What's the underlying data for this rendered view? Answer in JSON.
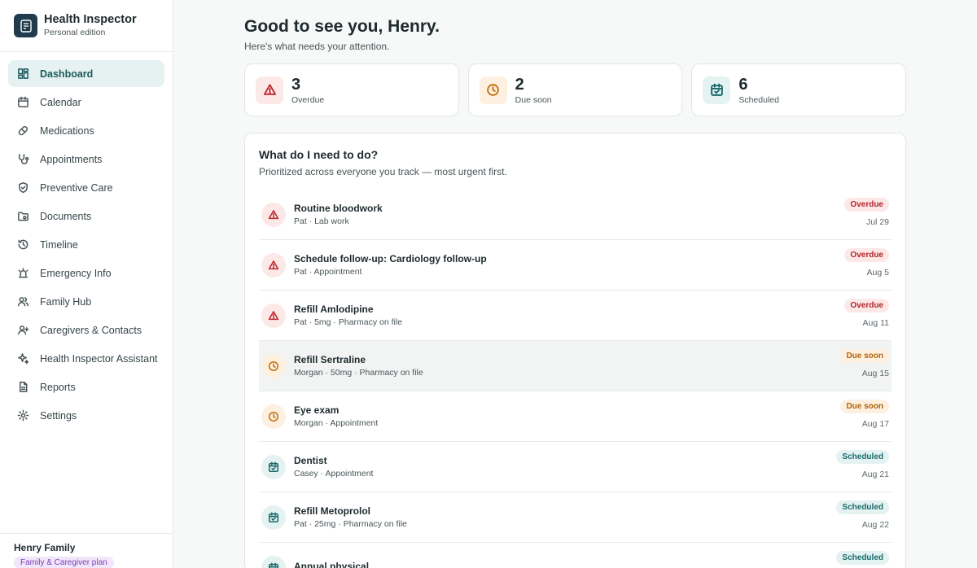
{
  "brand": {
    "title": "Health Inspector",
    "subtitle": "Personal edition"
  },
  "nav": [
    {
      "label": "Dashboard",
      "icon": "dashboard-icon",
      "active": true
    },
    {
      "label": "Calendar",
      "icon": "calendar-icon"
    },
    {
      "label": "Medications",
      "icon": "pill-icon"
    },
    {
      "label": "Appointments",
      "icon": "stethoscope-icon"
    },
    {
      "label": "Preventive Care",
      "icon": "shield-check-icon"
    },
    {
      "label": "Documents",
      "icon": "folder-icon"
    },
    {
      "label": "Timeline",
      "icon": "history-icon"
    },
    {
      "label": "Emergency Info",
      "icon": "siren-icon"
    },
    {
      "label": "Family Hub",
      "icon": "users-icon"
    },
    {
      "label": "Caregivers & Contacts",
      "icon": "user-plus-icon"
    },
    {
      "label": "Health Inspector Assistant",
      "icon": "sparkles-icon"
    },
    {
      "label": "Reports",
      "icon": "report-icon"
    },
    {
      "label": "Settings",
      "icon": "gear-icon"
    }
  ],
  "footer": {
    "family": "Henry Family",
    "plan": "Family & Caregiver plan"
  },
  "header": {
    "greeting": "Good to see you, Henry.",
    "subtitle": "Here's what needs your attention."
  },
  "stats": [
    {
      "value": "3",
      "label": "Overdue",
      "icon": "alert-triangle-icon",
      "status": "overdue"
    },
    {
      "value": "2",
      "label": "Due soon",
      "icon": "clock-icon",
      "status": "due"
    },
    {
      "value": "6",
      "label": "Scheduled",
      "icon": "calendar-check-icon",
      "status": "sched"
    }
  ],
  "tasks": {
    "title": "What do I need to do?",
    "subtitle": "Prioritized across everyone you track — most urgent first.",
    "items": [
      {
        "title": "Routine bloodwork",
        "meta": "Pat · Lab work",
        "badge": "Overdue",
        "date": "Jul 29",
        "status": "overdue"
      },
      {
        "title": "Schedule follow-up: Cardiology follow-up",
        "meta": "Pat · Appointment",
        "badge": "Overdue",
        "date": "Aug 5",
        "status": "overdue"
      },
      {
        "title": "Refill Amlodipine",
        "meta": "Pat · 5mg · Pharmacy on file",
        "badge": "Overdue",
        "date": "Aug 11",
        "status": "overdue"
      },
      {
        "title": "Refill Sertraline",
        "meta": "Morgan · 50mg · Pharmacy on file",
        "badge": "Due soon",
        "date": "Aug 15",
        "status": "due",
        "highlight": true
      },
      {
        "title": "Eye exam",
        "meta": "Morgan · Appointment",
        "badge": "Due soon",
        "date": "Aug 17",
        "status": "due"
      },
      {
        "title": "Dentist",
        "meta": "Casey · Appointment",
        "badge": "Scheduled",
        "date": "Aug 21",
        "status": "sched"
      },
      {
        "title": "Refill Metoprolol",
        "meta": "Pat · 25mg · Pharmacy on file",
        "badge": "Scheduled",
        "date": "Aug 22",
        "status": "sched"
      },
      {
        "title": "Annual physical",
        "meta": "",
        "badge": "Scheduled",
        "date": "",
        "status": "sched"
      }
    ]
  },
  "colors": {
    "accent": "#1a5a5c",
    "overdue": "#c0282d",
    "due": "#c4700f",
    "scheduled": "#1a6a6c"
  }
}
